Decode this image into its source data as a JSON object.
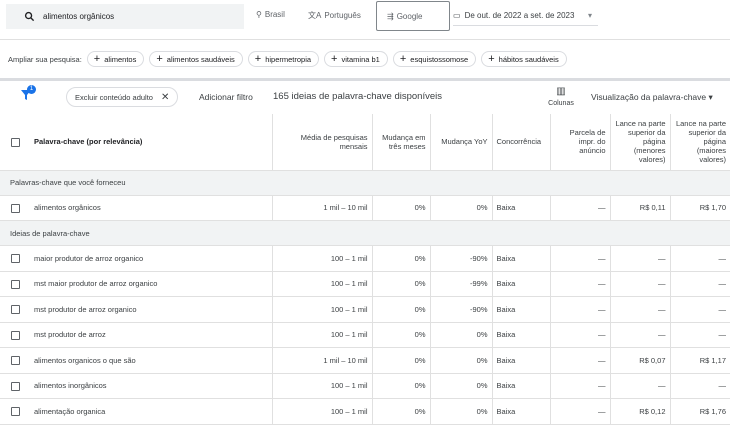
{
  "search": {
    "query": "alimentos orgânicos"
  },
  "location": "Brasil",
  "language": "Português",
  "network": "Google",
  "date_range": "De out. de 2022 a set. de 2023",
  "broaden": {
    "label": "Ampliar sua pesquisa:",
    "chips": [
      "alimentos",
      "alimentos saudáveis",
      "hipermetropia",
      "vitamina b1",
      "esquistossomose",
      "hábitos saudáveis"
    ]
  },
  "toolbar": {
    "filter_badge": "1",
    "filter_chip": "Excluir conteúdo adulto",
    "add_filter": "Adicionar filtro",
    "count_text": "165 ideias de palavra-chave disponíveis",
    "columns": "Colunas",
    "view": "Visualização da palavra-chave"
  },
  "table": {
    "headers": [
      "Palavra-chave (por relevância)",
      "Média de pesquisas mensais",
      "Mudança em três meses",
      "Mudança YoY",
      "Concorrência",
      "Parcela de impr. do anúncio",
      "Lance na parte superior da página (menores valores)",
      "Lance na parte superior da página (maiores valores)"
    ],
    "group1": "Palavras-chave que você forneceu",
    "provided": [
      [
        "alimentos orgânicos",
        "1 mil – 10 mil",
        "0%",
        "0%",
        "Baixa",
        "—",
        "R$ 0,11",
        "R$ 1,70"
      ]
    ],
    "group2": "Ideias de palavra-chave",
    "ideas": [
      [
        "maior produtor de arroz organico",
        "100 – 1 mil",
        "0%",
        "-90%",
        "Baixa",
        "—",
        "—",
        "—"
      ],
      [
        "mst maior produtor de arroz organico",
        "100 – 1 mil",
        "0%",
        "-99%",
        "Baixa",
        "—",
        "—",
        "—"
      ],
      [
        "mst produtor de arroz organico",
        "100 – 1 mil",
        "0%",
        "-90%",
        "Baixa",
        "—",
        "—",
        "—"
      ],
      [
        "mst produtor de arroz",
        "100 – 1 mil",
        "0%",
        "0%",
        "Baixa",
        "—",
        "—",
        "—"
      ],
      [
        "alimentos organicos o que são",
        "1 mil – 10 mil",
        "0%",
        "0%",
        "Baixa",
        "—",
        "R$ 0,07",
        "R$ 1,17"
      ],
      [
        "alimentos inorgânicos",
        "100 – 1 mil",
        "0%",
        "0%",
        "Baixa",
        "—",
        "—",
        "—"
      ],
      [
        "alimentação organica",
        "100 – 1 mil",
        "0%",
        "0%",
        "Baixa",
        "—",
        "R$ 0,12",
        "R$ 1,76"
      ]
    ]
  }
}
